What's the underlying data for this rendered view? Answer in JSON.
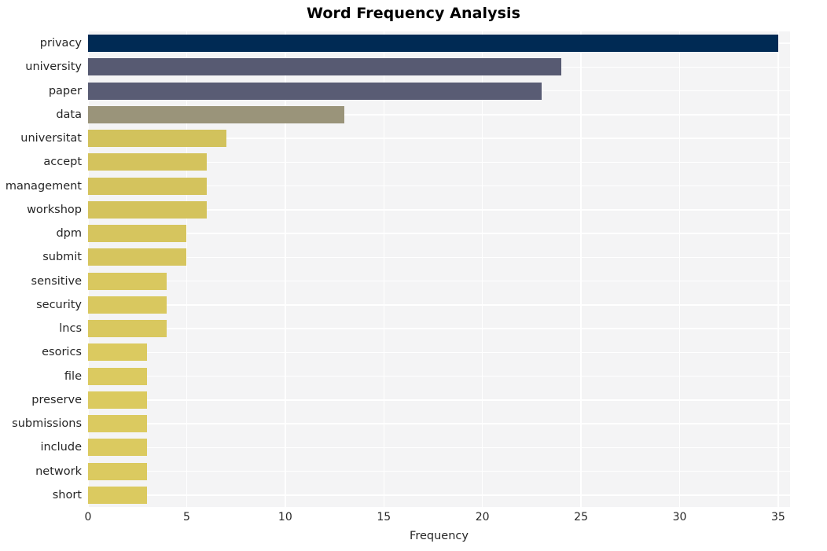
{
  "chart_data": {
    "type": "bar",
    "orientation": "horizontal",
    "title": "Word Frequency Analysis",
    "xlabel": "Frequency",
    "ylabel": "",
    "xlim": [
      0,
      35.6
    ],
    "xticks": [
      0,
      5,
      10,
      15,
      20,
      25,
      30,
      35
    ],
    "xtick_labels": [
      "0",
      "5",
      "10",
      "15",
      "20",
      "25",
      "30",
      "35"
    ],
    "grid": true,
    "legend": "none",
    "categories": [
      "privacy",
      "university",
      "paper",
      "data",
      "universitat",
      "accept",
      "management",
      "workshop",
      "dpm",
      "submit",
      "sensitive",
      "security",
      "lncs",
      "esorics",
      "file",
      "preserve",
      "submissions",
      "include",
      "network",
      "short"
    ],
    "values": [
      35,
      24,
      23,
      13,
      7,
      6,
      6,
      6,
      5,
      5,
      4,
      4,
      4,
      3,
      3,
      3,
      3,
      3,
      3,
      3
    ],
    "bar_colors": [
      "#002a54",
      "#575a72",
      "#595c74",
      "#9a947a",
      "#d2c25c",
      "#d4c35d",
      "#d4c35d",
      "#d4c35d",
      "#d6c55e",
      "#d6c55e",
      "#d9c85f",
      "#d9c85f",
      "#d9c85f",
      "#dbca60",
      "#dbca60",
      "#dbca60",
      "#dbca60",
      "#dbca60",
      "#dbca60",
      "#dbca60"
    ],
    "colormap": "cividis",
    "plot_background": "#f4f4f5",
    "grid_color": "#ffffff",
    "figure_background": "#ffffff"
  }
}
